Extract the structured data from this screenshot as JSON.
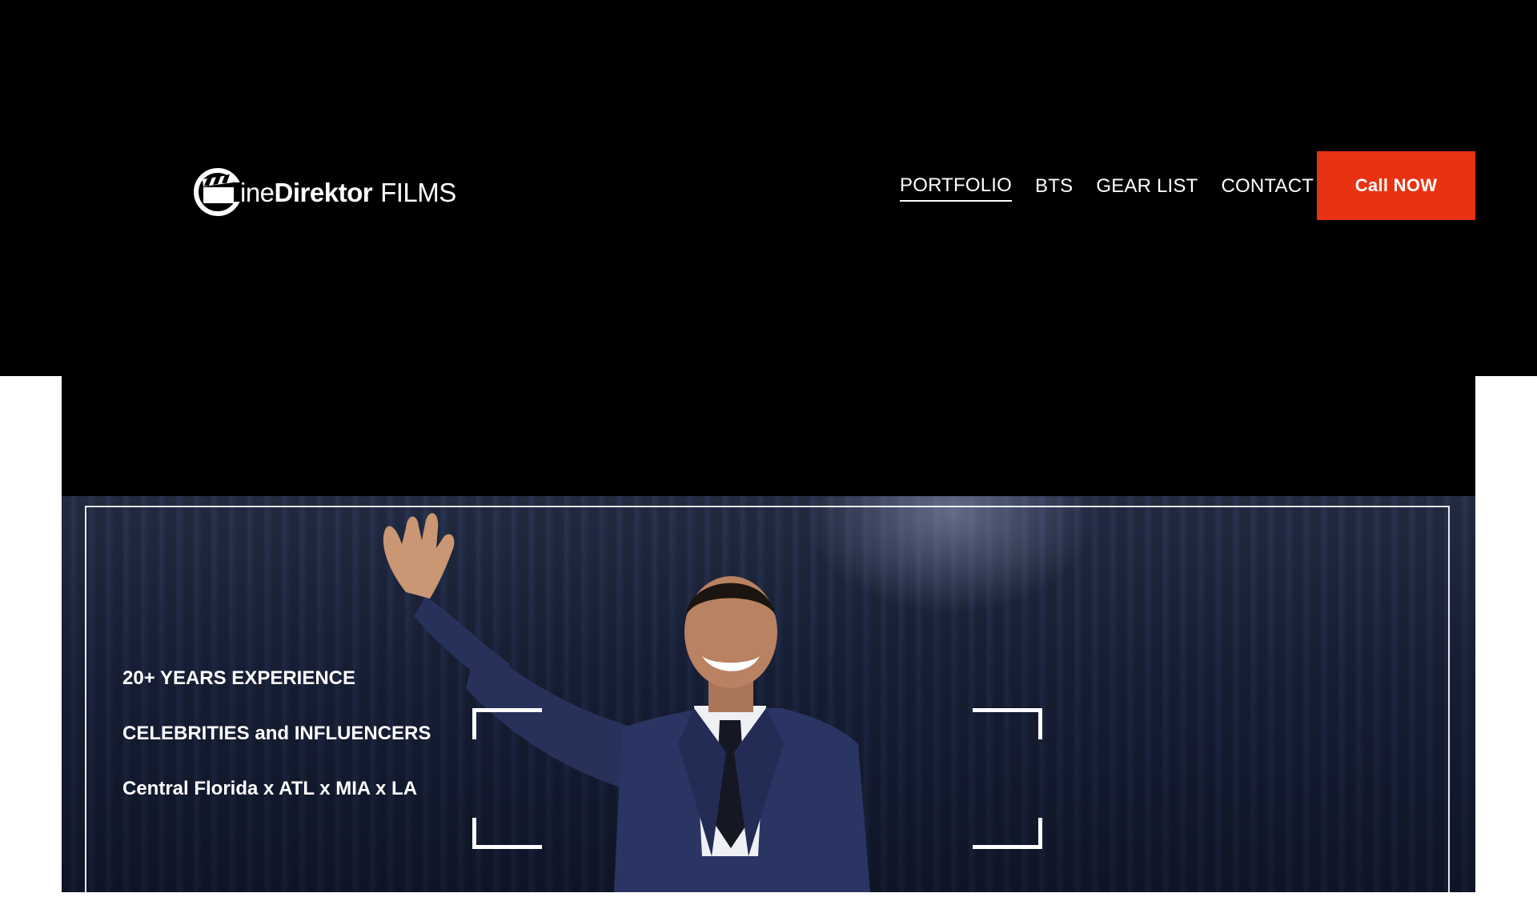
{
  "logo": {
    "icon": "film-clapper-c-icon",
    "text_light": "ine",
    "text_bold": "Direktor",
    "text_suffix": "FILMS"
  },
  "nav": {
    "items": [
      {
        "label": "PORTFOLIO",
        "active": true
      },
      {
        "label": "BTS",
        "active": false
      },
      {
        "label": "GEAR LIST",
        "active": false
      },
      {
        "label": "CONTACT",
        "active": false
      }
    ]
  },
  "cta": {
    "label": "Call NOW",
    "color": "#e83211"
  },
  "hero": {
    "lines": [
      "20+ YEARS EXPERIENCE",
      "CELEBRITIES and INFLUENCERS",
      "Central Florida x  ATL x MIA x LA"
    ],
    "image": "performer-waving-on-stage"
  }
}
